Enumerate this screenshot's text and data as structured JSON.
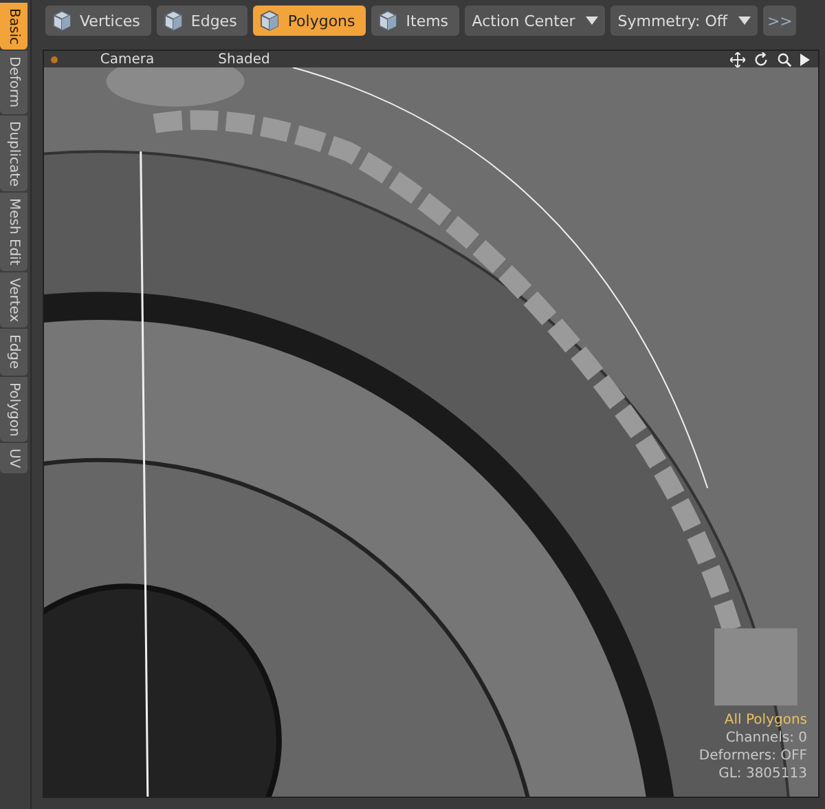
{
  "side_tabs": [
    {
      "label": "Basic",
      "selected": true
    },
    {
      "label": "Deform",
      "selected": false
    },
    {
      "label": "Duplicate",
      "selected": false
    },
    {
      "label": "Mesh Edit",
      "selected": false
    },
    {
      "label": "Vertex",
      "selected": false
    },
    {
      "label": "Edge",
      "selected": false
    },
    {
      "label": "Polygon",
      "selected": false
    },
    {
      "label": "UV",
      "selected": false
    }
  ],
  "modes": [
    {
      "label": "Vertices",
      "selected": false
    },
    {
      "label": "Edges",
      "selected": false
    },
    {
      "label": "Polygons",
      "selected": true
    },
    {
      "label": "Items",
      "selected": false
    }
  ],
  "dropdowns": [
    {
      "label": "Action Center"
    },
    {
      "label": "Symmetry: Off"
    }
  ],
  "more_button": ">>",
  "viewport": {
    "camera": "Camera",
    "shading": "Shaded",
    "info": [
      {
        "text": "All Polygons",
        "kind": "selection"
      },
      {
        "text": "Channels: 0",
        "kind": "stat"
      },
      {
        "text": "Deformers: OFF",
        "kind": "stat"
      },
      {
        "text": "GL: 3805113",
        "kind": "stat"
      }
    ]
  }
}
